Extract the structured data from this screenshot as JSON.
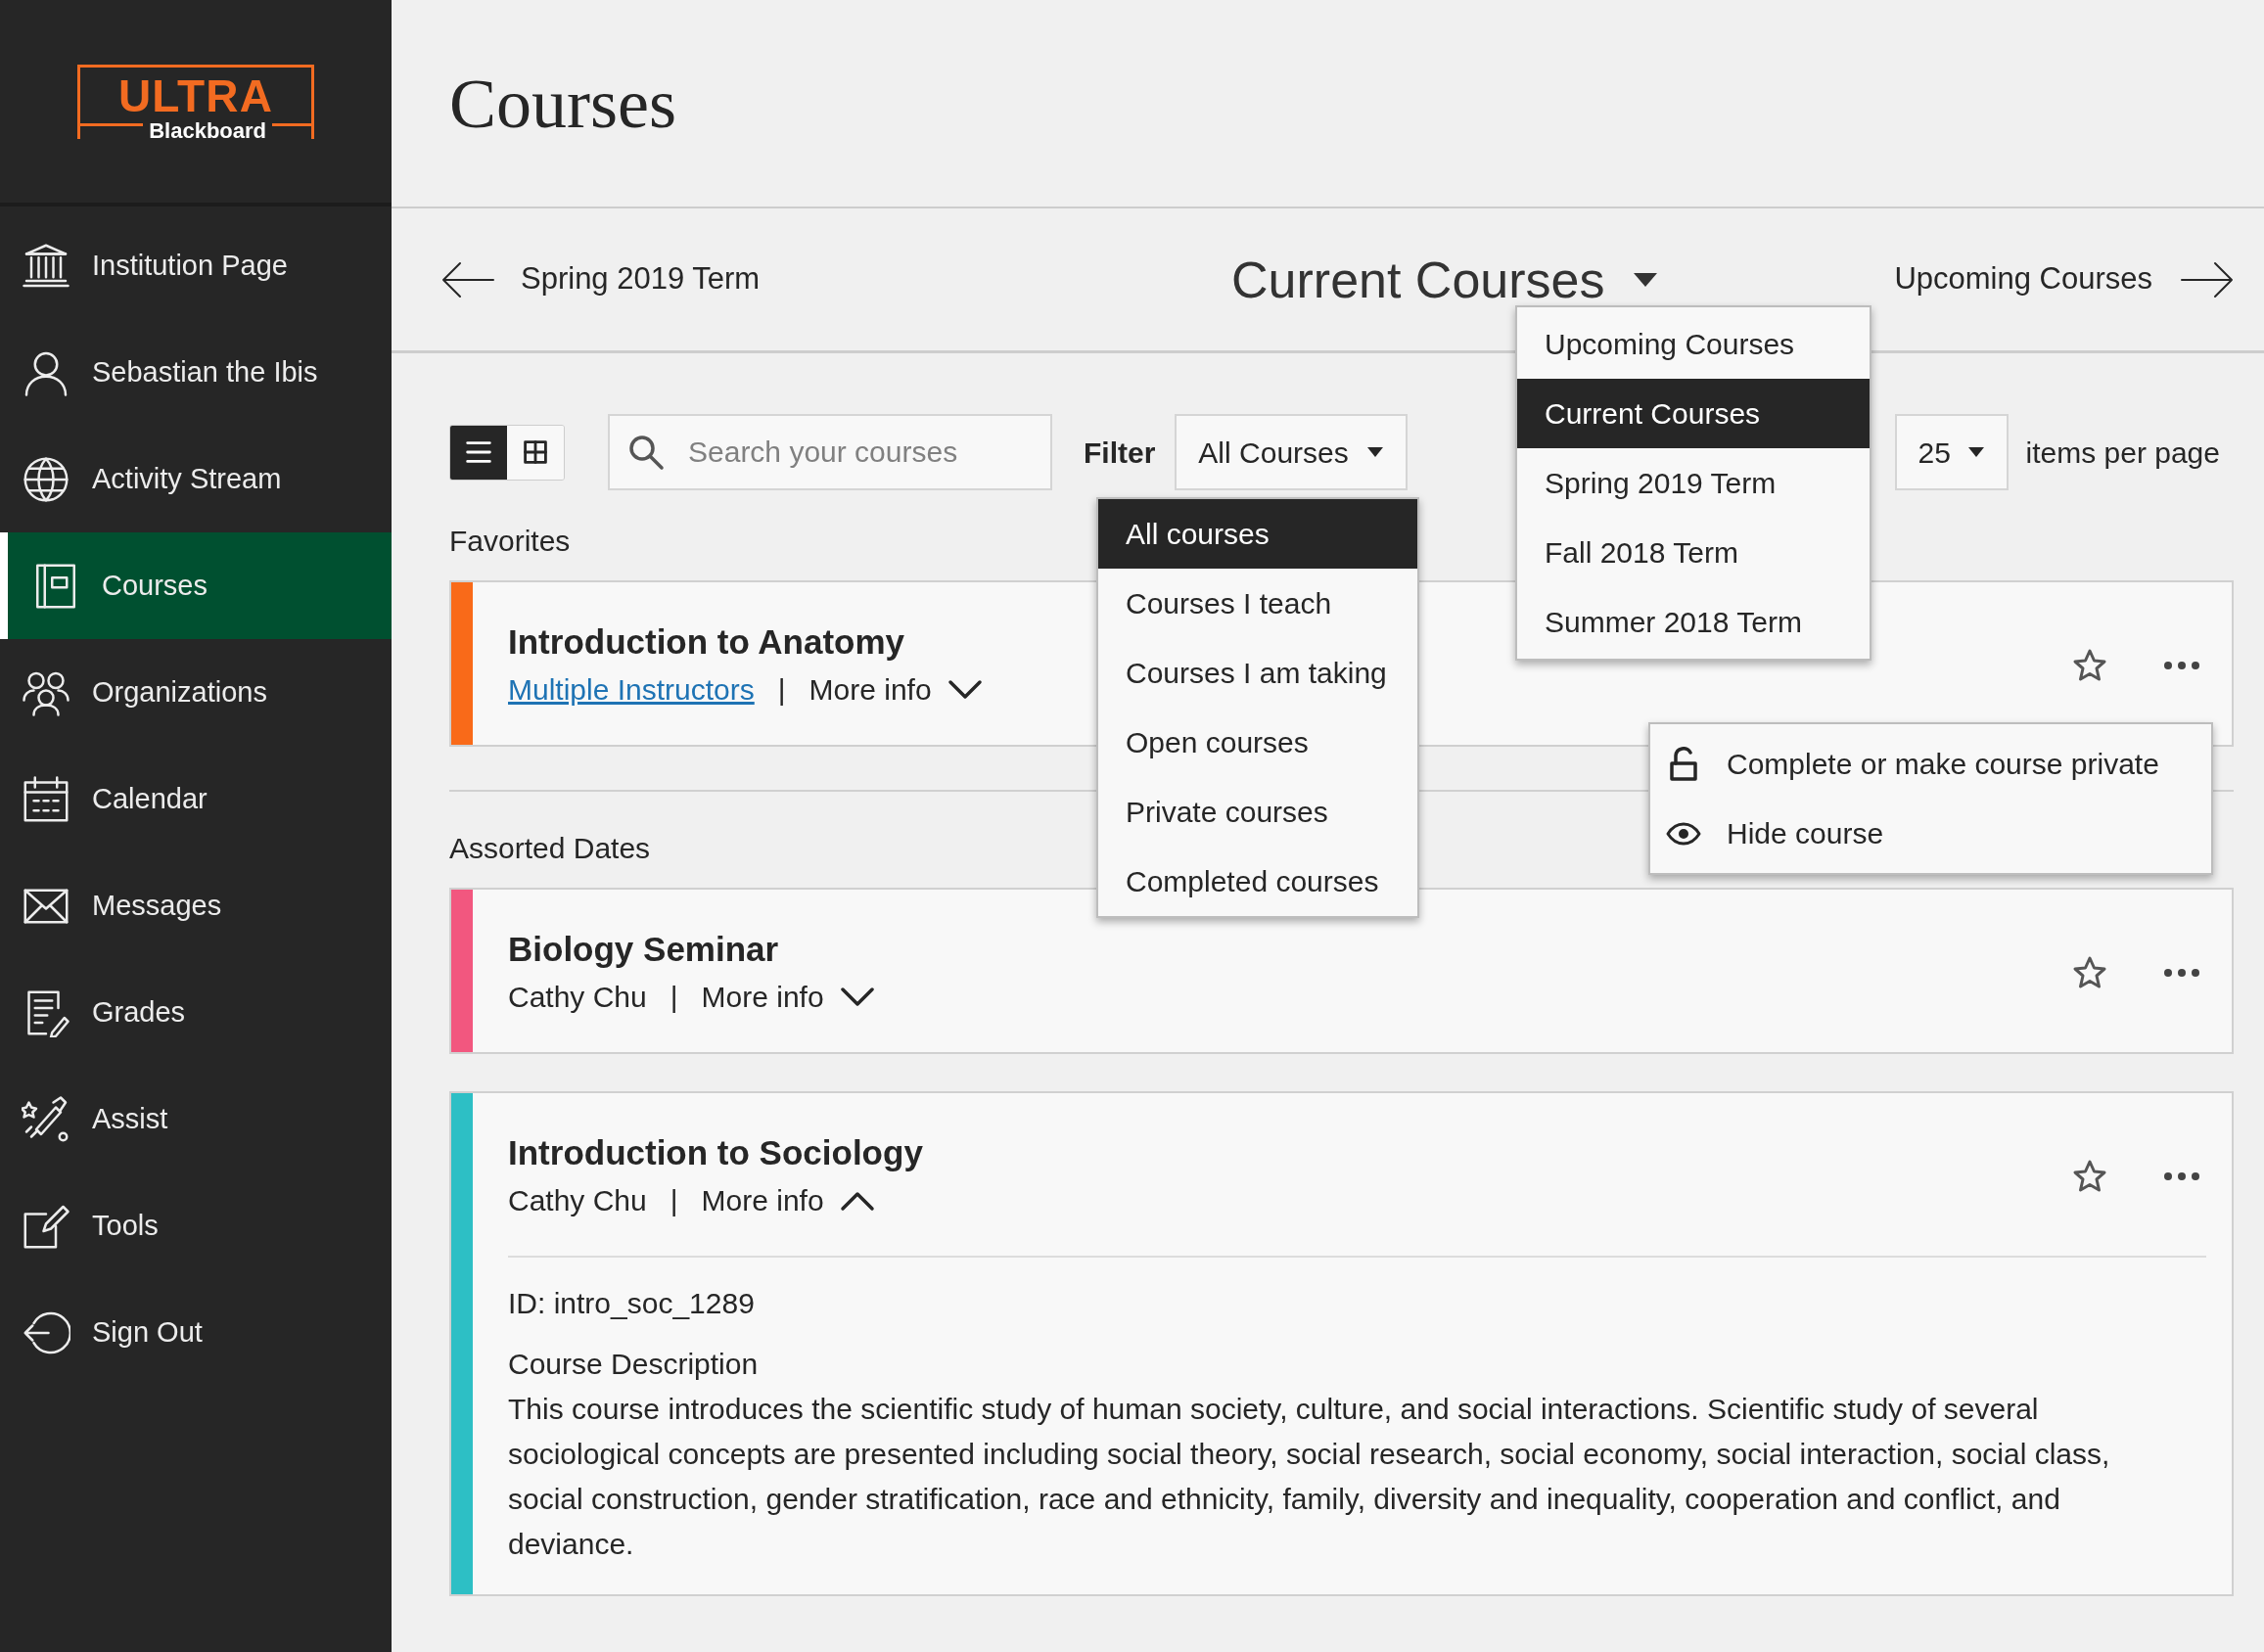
{
  "sidebar": {
    "logo": {
      "title": "ULTRA",
      "subtitle": "Blackboard"
    },
    "items": [
      {
        "label": "Institution Page",
        "selected": false
      },
      {
        "label": "Sebastian the Ibis",
        "selected": false
      },
      {
        "label": "Activity Stream",
        "selected": false
      },
      {
        "label": "Courses",
        "selected": true
      },
      {
        "label": "Organizations",
        "selected": false
      },
      {
        "label": "Calendar",
        "selected": false
      },
      {
        "label": "Messages",
        "selected": false
      },
      {
        "label": "Grades",
        "selected": false
      },
      {
        "label": "Assist",
        "selected": false
      },
      {
        "label": "Tools",
        "selected": false
      },
      {
        "label": "Sign Out",
        "selected": false
      }
    ]
  },
  "page_title": "Courses",
  "term_nav": {
    "previous": "Spring 2019 Term",
    "current": "Current Courses",
    "next": "Upcoming Courses"
  },
  "term_menu": [
    {
      "label": "Upcoming Courses",
      "selected": false
    },
    {
      "label": "Current Courses",
      "selected": true
    },
    {
      "label": "Spring 2019 Term",
      "selected": false
    },
    {
      "label": "Fall 2018 Term",
      "selected": false
    },
    {
      "label": "Summer 2018 Term",
      "selected": false
    }
  ],
  "toolbar": {
    "view_toggle": [
      {
        "selected": true
      },
      {
        "selected": false
      }
    ],
    "search": {
      "placeholder": "Search your courses"
    },
    "filter": {
      "label": "Filter",
      "value": "All Courses"
    },
    "page_size": {
      "value": "25",
      "label": "items per page"
    }
  },
  "filter_menu": [
    {
      "label": "All courses",
      "selected": true
    },
    {
      "label": "Courses I teach",
      "selected": false
    },
    {
      "label": "Courses I am taking",
      "selected": false
    },
    {
      "label": "Open courses",
      "selected": false
    },
    {
      "label": "Private courses",
      "selected": false
    },
    {
      "label": "Completed courses",
      "selected": false
    }
  ],
  "sections": [
    {
      "heading": "Favorites",
      "courses": [
        {
          "title": "Introduction to Anatomy",
          "instructor": "Multiple Instructors",
          "instructor_is_link": true,
          "separator": "|",
          "more_info": "More info",
          "expanded": false,
          "favorite": false,
          "color": "#f96a19"
        }
      ]
    },
    {
      "heading": "Assorted Dates",
      "courses": [
        {
          "title": "Biology Seminar",
          "instructor": "Cathy Chu",
          "instructor_is_link": false,
          "separator": "|",
          "more_info": "More info",
          "expanded": false,
          "favorite": false,
          "color": "#f2577f"
        },
        {
          "title": "Introduction to Sociology",
          "instructor": "Cathy Chu",
          "instructor_is_link": false,
          "separator": "|",
          "more_info": "More info",
          "expanded": true,
          "favorite": false,
          "color": "#2dbfc5",
          "details": {
            "id": "ID: intro_soc_1289",
            "description_heading": "Course Description",
            "description": "This course introduces the scientific study of human society, culture, and social interactions. Scientific study of several sociological concepts are presented including social theory, social research, social economy, social interaction, social class, social construction, gender stratification, race and ethnicity, family, diversity and inequality, cooperation and conflict, and deviance."
          }
        }
      ]
    }
  ],
  "course_menu": [
    {
      "label": "Complete or make course private"
    },
    {
      "label": "Hide course"
    }
  ]
}
